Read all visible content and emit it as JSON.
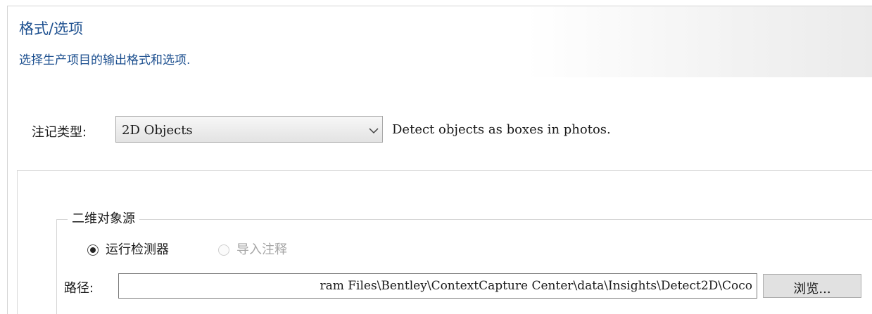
{
  "header": {
    "title": "格式/选项",
    "subtitle": "选择生产项目的输出格式和选项."
  },
  "annotation_type": {
    "label": "注记类型:",
    "selected_value": "2D Objects",
    "description": "Detect objects as boxes in photos.",
    "dropdown_icon": "chevron-down-icon"
  },
  "source_group": {
    "legend": "二维对象源",
    "options": [
      {
        "label": "运行检测器",
        "checked": true,
        "enabled": true
      },
      {
        "label": "导入注释",
        "checked": false,
        "enabled": false
      }
    ],
    "path_label": "路径:",
    "path_value": "ram Files\\Bentley\\ContextCapture Center\\data\\Insights\\Detect2D\\Coco",
    "browse_label": "浏览..."
  },
  "colors": {
    "header_text": "#1c4f8f",
    "disabled_text": "#a6a6a6"
  }
}
